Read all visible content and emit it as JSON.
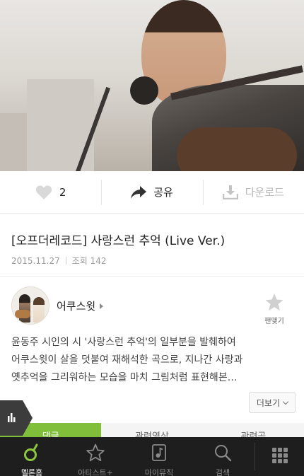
{
  "actions": {
    "like_count": "2",
    "share_label": "공유",
    "download_label": "다운로드"
  },
  "video": {
    "title": "[오프더레코드] 사랑스런 추억 (Live Ver.)",
    "date": "2015.11.27",
    "views_label": "조회 142"
  },
  "artist": {
    "name": "어쿠스윗",
    "fan_label": "팬맺기"
  },
  "description": {
    "line1": "윤동주 시인의 시 '사랑스런 추억'의 일부분을 발췌하여",
    "line2": "어쿠스윗이 살을 덧붙여 재해석한 곡으로, 지나간 사랑과",
    "line3": "옛추억을 그리워하는 모습을 마치 그림처럼 표현해본…",
    "more_label": "더보기"
  },
  "tabs": [
    {
      "label": "댓글"
    },
    {
      "label": "관련영상"
    },
    {
      "label": "관련곡"
    }
  ],
  "bottom_nav": [
    {
      "label": "멜론홈",
      "icon": "melon-home-icon",
      "active": true
    },
    {
      "label": "아티스트+",
      "icon": "star-icon"
    },
    {
      "label": "마이뮤직",
      "icon": "my-music-icon"
    },
    {
      "label": "검색",
      "icon": "search-icon"
    }
  ],
  "colors": {
    "accent": "#7fbf3a",
    "nav_bg": "#1e1e1e"
  }
}
